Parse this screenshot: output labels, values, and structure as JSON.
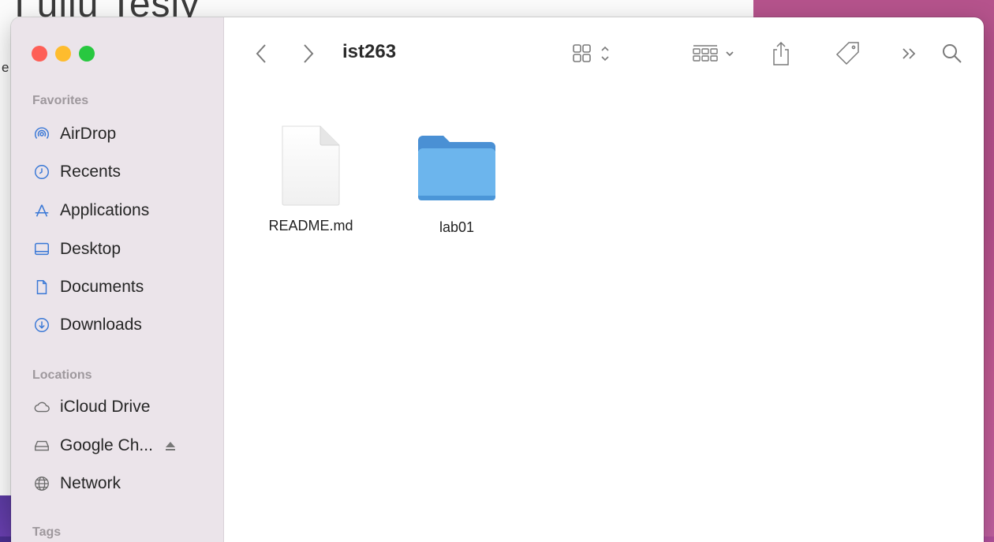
{
  "background": {
    "doc_title": "I ullu Tesly",
    "doc_letter": "e"
  },
  "window": {
    "title": "ist263"
  },
  "sidebar": {
    "favorites_header": "Favorites",
    "favorites": [
      {
        "label": "AirDrop",
        "icon": "airdrop-icon"
      },
      {
        "label": "Recents",
        "icon": "clock-icon"
      },
      {
        "label": "Applications",
        "icon": "applications-icon"
      },
      {
        "label": "Desktop",
        "icon": "desktop-icon"
      },
      {
        "label": "Documents",
        "icon": "document-icon"
      },
      {
        "label": "Downloads",
        "icon": "download-icon"
      }
    ],
    "locations_header": "Locations",
    "locations": [
      {
        "label": "iCloud Drive",
        "icon": "cloud-icon"
      },
      {
        "label": "Google Ch...",
        "icon": "drive-icon"
      },
      {
        "label": "Network",
        "icon": "network-icon"
      }
    ],
    "tags_header": "Tags"
  },
  "toolbar": {
    "icons": [
      "back-icon",
      "forward-icon",
      "icon-view-icon",
      "group-icon",
      "share-icon",
      "tag-icon",
      "more-icon",
      "search-icon"
    ]
  },
  "files": [
    {
      "name": "README.md",
      "kind": "document"
    },
    {
      "name": "lab01",
      "kind": "folder"
    }
  ],
  "colors": {
    "sidebar_bg": "#ebe4ea",
    "folder_blue": "#5aa9e6",
    "close": "#fe5f57",
    "minimize": "#febc2e",
    "zoom": "#28c840"
  }
}
